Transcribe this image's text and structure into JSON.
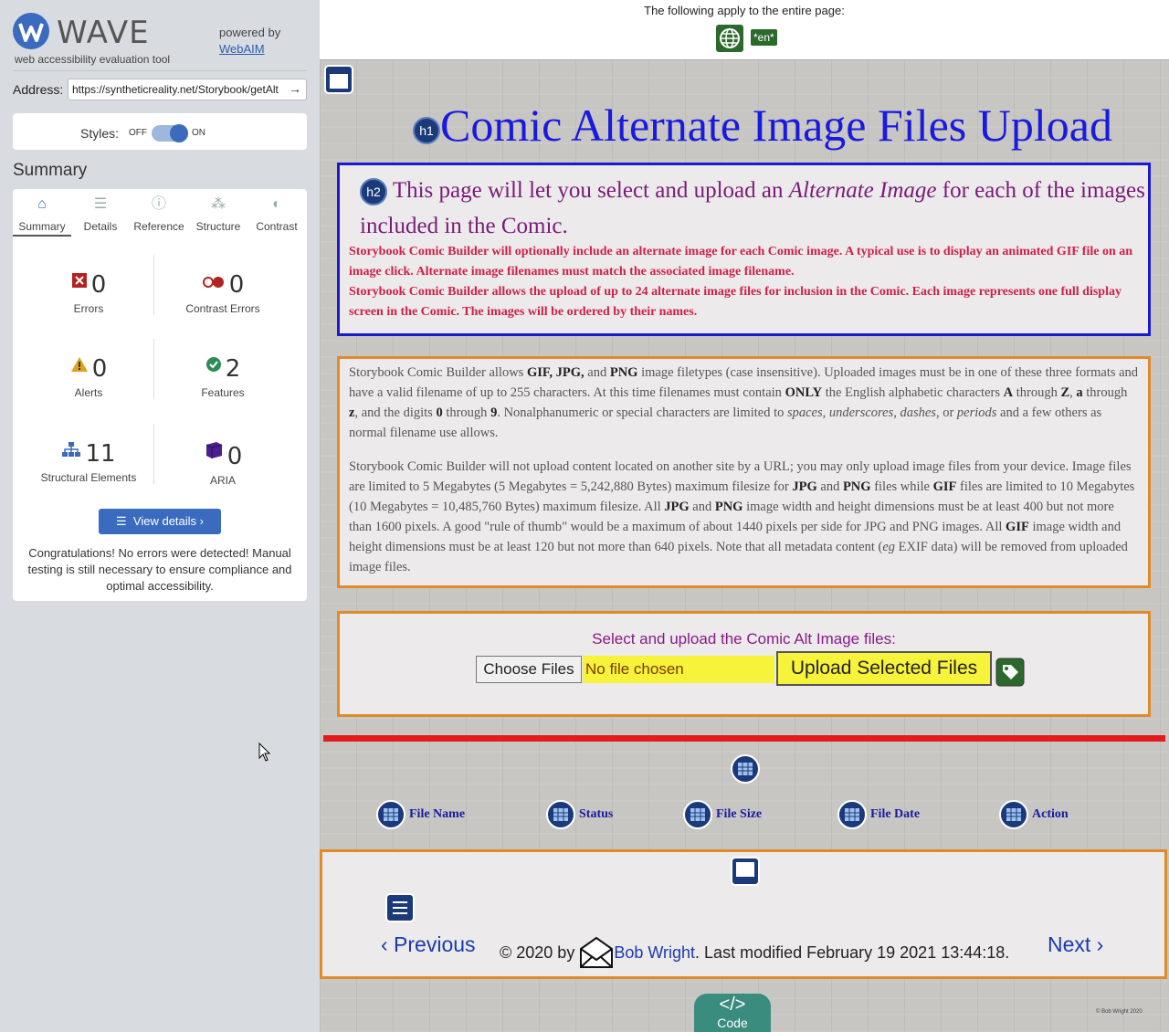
{
  "wave": {
    "title": "WAVE",
    "subtitle": "web accessibility evaluation tool",
    "powered_by": "powered by",
    "webaim": "WebAIM",
    "address_label": "Address:",
    "address_value": "https://syntheticreality.net/Storybook/getAlt",
    "styles_label": "Styles:",
    "styles_off": "OFF",
    "styles_on": "ON",
    "summary_heading": "Summary",
    "tabs": [
      {
        "label": "Summary",
        "icon": "home-icon",
        "active": true
      },
      {
        "label": "Details",
        "icon": "list-icon"
      },
      {
        "label": "Reference",
        "icon": "info-icon"
      },
      {
        "label": "Structure",
        "icon": "hierarchy-icon"
      },
      {
        "label": "Contrast",
        "icon": "contrast-icon"
      }
    ],
    "stats": {
      "errors": {
        "count": "0",
        "label": "Errors"
      },
      "contrast": {
        "count": "0",
        "label": "Contrast Errors"
      },
      "alerts": {
        "count": "0",
        "label": "Alerts"
      },
      "features": {
        "count": "2",
        "label": "Features"
      },
      "structure": {
        "count": "11",
        "label": "Structural Elements"
      },
      "aria": {
        "count": "0",
        "label": "ARIA"
      }
    },
    "view_details": "View details ›",
    "congrats": "Congratulations! No errors were detected! Manual testing is still necessary to ensure compliance and optimal accessibility."
  },
  "page": {
    "topbar_text": "The following apply to the entire page:",
    "lang_badge": "*en*",
    "h1_badge": "h1",
    "h1": "Comic Alternate Image Files Upload",
    "h2_badge": "h2",
    "h2_part1": "This page will let you select and upload an ",
    "h2_em": "Alternate Image",
    "h2_part2": " for each of the images included in the Comic.",
    "intro1": "Storybook Comic Builder will optionally include an alternate image for each Comic image. A typical use is to display an animated GIF file on an image click. Alternate image filenames must match the associated image filename.",
    "intro2": "Storybook Comic Builder allows the upload of up to 24 alternate image files for inclusion in the Comic. Each image represents one full display screen in the Comic. The images will be ordered by their names.",
    "select_title": "Select and upload the Comic Alt Image files:",
    "choose_files": "Choose Files",
    "no_file": "No file chosen",
    "upload_button": "Upload Selected Files",
    "table_headers": [
      "File Name",
      "Status",
      "File Size",
      "File Date",
      "Action"
    ],
    "previous": "‹ Previous",
    "copyright": "© 2020 by ",
    "author": "Bob Wright",
    "modified": ". Last modified February 19 2021 13:44:18.",
    "next": "Next ›",
    "code_tab": "Code",
    "credit": "© Bob Wright 2020"
  },
  "colors": {
    "wave_blue": "#3a6bbf",
    "heading_blue": "#1a1adf",
    "h2_purple": "#7a1a7a",
    "intro_red": "#d01f4a",
    "orange_border": "#e08a2a",
    "upload_yellow": "#f7f33a"
  }
}
